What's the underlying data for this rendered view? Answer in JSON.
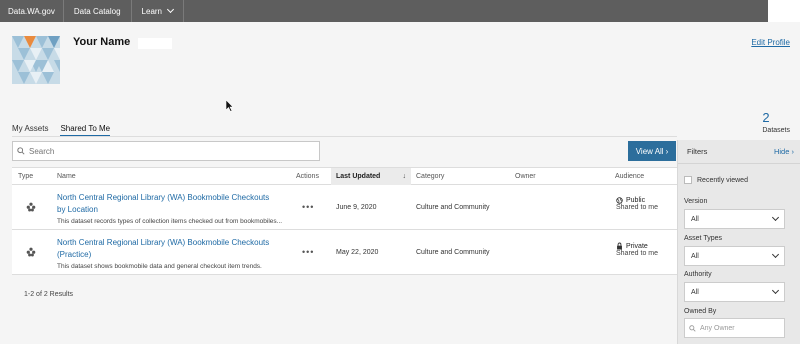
{
  "nav": {
    "brand": "Data.WA.gov",
    "data_catalog": "Data Catalog",
    "learn": "Learn"
  },
  "profile": {
    "name": "Your Name",
    "edit_link": "Edit Profile"
  },
  "tabs": [
    {
      "label": "My Assets"
    },
    {
      "label": "Shared To Me"
    }
  ],
  "datasets_count": {
    "number": "2",
    "label": "Datasets"
  },
  "search": {
    "placeholder": "Search"
  },
  "view_all": "View All",
  "table": {
    "headers": {
      "type": "Type",
      "name": "Name",
      "actions": "Actions",
      "last_updated": "Last Updated",
      "category": "Category",
      "owner": "Owner",
      "audience": "Audience"
    },
    "rows": [
      {
        "title": "North Central Regional Library (WA) Bookmobile Checkouts by Location",
        "description": "This dataset records types of collection items checked out from bookmobiles...",
        "actions": "•••",
        "last_updated": "June 9, 2020",
        "category": "Culture and Community",
        "owner": "",
        "audience": "Public",
        "shared": "Shared to me"
      },
      {
        "title": "North Central Regional Library (WA) Bookmobile Checkouts (Practice)",
        "description": "This dataset shows bookmobile data and general checkout item trends.",
        "actions": "•••",
        "last_updated": "May 22, 2020",
        "category": "Culture and Community",
        "owner": "",
        "audience": "Private",
        "shared": "Shared to me"
      }
    ]
  },
  "results_text": "1-2 of 2 Results",
  "filters": {
    "title": "Filters",
    "hide": "Hide",
    "recently_viewed": "Recently viewed",
    "version_label": "Version",
    "version_value": "All",
    "asset_types_label": "Asset Types",
    "asset_types_value": "All",
    "authority_label": "Authority",
    "authority_value": "All",
    "owned_by_label": "Owned By",
    "owned_by_placeholder": "Any Owner"
  },
  "colors": {
    "nav_bg": "#5e5e5e",
    "link": "#1f6aa5",
    "button": "#2c6e9c"
  }
}
